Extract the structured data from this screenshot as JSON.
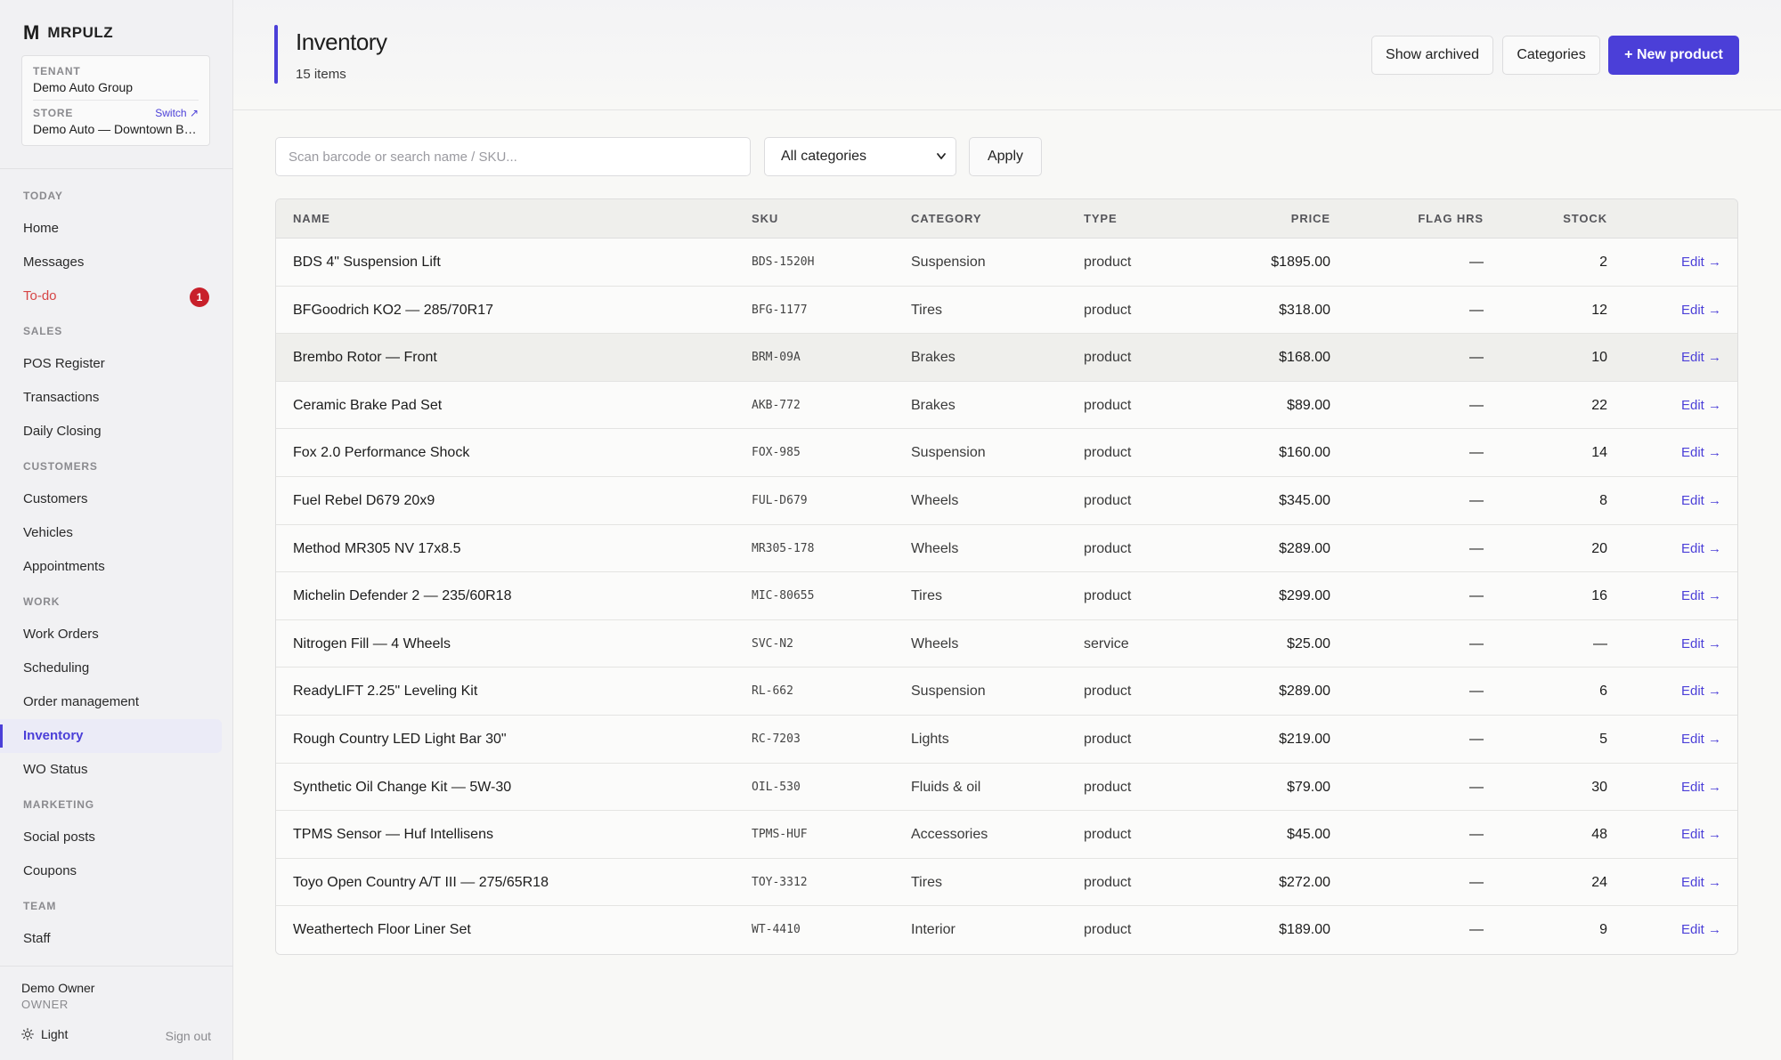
{
  "brand": {
    "logo": "M",
    "name": "MRPULZ"
  },
  "context": {
    "tenant_label": "TENANT",
    "tenant_value": "Demo Auto Group",
    "store_label": "STORE",
    "store_value": "Demo Auto — Downtown Branch",
    "switch_label": "Switch ↗"
  },
  "nav": {
    "sections": [
      {
        "label": "TODAY",
        "items": [
          {
            "label": "Home"
          },
          {
            "label": "Messages"
          },
          {
            "label": "To-do",
            "badge": "1"
          }
        ]
      },
      {
        "label": "SALES",
        "items": [
          {
            "label": "POS Register"
          },
          {
            "label": "Transactions"
          },
          {
            "label": "Daily Closing"
          }
        ]
      },
      {
        "label": "CUSTOMERS",
        "items": [
          {
            "label": "Customers"
          },
          {
            "label": "Vehicles"
          },
          {
            "label": "Appointments"
          }
        ]
      },
      {
        "label": "WORK",
        "items": [
          {
            "label": "Work Orders"
          },
          {
            "label": "Scheduling"
          },
          {
            "label": "Order management"
          },
          {
            "label": "Inventory",
            "active": true
          },
          {
            "label": "WO Status"
          }
        ]
      },
      {
        "label": "MARKETING",
        "items": [
          {
            "label": "Social posts"
          },
          {
            "label": "Coupons"
          }
        ]
      },
      {
        "label": "TEAM",
        "items": [
          {
            "label": "Staff"
          }
        ]
      }
    ]
  },
  "footer": {
    "owner_name": "Demo Owner",
    "owner_role": "OWNER",
    "theme_label": "Light",
    "signout_label": "Sign out"
  },
  "header": {
    "title": "Inventory",
    "subtitle": "15 items"
  },
  "actions": {
    "show_archived": "Show archived",
    "categories": "Categories",
    "new_product": "+ New product"
  },
  "filters": {
    "search_placeholder": "Scan barcode or search name / SKU...",
    "category_selected": "All categories",
    "apply_label": "Apply"
  },
  "table": {
    "columns": {
      "name": "NAME",
      "sku": "SKU",
      "category": "CATEGORY",
      "type": "TYPE",
      "price": "PRICE",
      "flag_hrs": "FLAG HRS",
      "stock": "STOCK"
    },
    "edit_label": "Edit →",
    "highlight_row": 2,
    "rows": [
      {
        "name": "BDS 4\" Suspension Lift",
        "sku": "BDS-1520H",
        "category": "Suspension",
        "type": "product",
        "price": "$1895.00",
        "flag_hrs": "—",
        "stock": "2"
      },
      {
        "name": "BFGoodrich KO2 — 285/70R17",
        "sku": "BFG-1177",
        "category": "Tires",
        "type": "product",
        "price": "$318.00",
        "flag_hrs": "—",
        "stock": "12"
      },
      {
        "name": "Brembo Rotor — Front",
        "sku": "BRM-09A",
        "category": "Brakes",
        "type": "product",
        "price": "$168.00",
        "flag_hrs": "—",
        "stock": "10"
      },
      {
        "name": "Ceramic Brake Pad Set",
        "sku": "AKB-772",
        "category": "Brakes",
        "type": "product",
        "price": "$89.00",
        "flag_hrs": "—",
        "stock": "22"
      },
      {
        "name": "Fox 2.0 Performance Shock",
        "sku": "FOX-985",
        "category": "Suspension",
        "type": "product",
        "price": "$160.00",
        "flag_hrs": "—",
        "stock": "14"
      },
      {
        "name": "Fuel Rebel D679 20x9",
        "sku": "FUL-D679",
        "category": "Wheels",
        "type": "product",
        "price": "$345.00",
        "flag_hrs": "—",
        "stock": "8"
      },
      {
        "name": "Method MR305 NV 17x8.5",
        "sku": "MR305-178",
        "category": "Wheels",
        "type": "product",
        "price": "$289.00",
        "flag_hrs": "—",
        "stock": "20"
      },
      {
        "name": "Michelin Defender 2 — 235/60R18",
        "sku": "MIC-80655",
        "category": "Tires",
        "type": "product",
        "price": "$299.00",
        "flag_hrs": "—",
        "stock": "16"
      },
      {
        "name": "Nitrogen Fill — 4 Wheels",
        "sku": "SVC-N2",
        "category": "Wheels",
        "type": "service",
        "price": "$25.00",
        "flag_hrs": "—",
        "stock": "—"
      },
      {
        "name": "ReadyLIFT 2.25\" Leveling Kit",
        "sku": "RL-662",
        "category": "Suspension",
        "type": "product",
        "price": "$289.00",
        "flag_hrs": "—",
        "stock": "6"
      },
      {
        "name": "Rough Country LED Light Bar 30\"",
        "sku": "RC-7203",
        "category": "Lights",
        "type": "product",
        "price": "$219.00",
        "flag_hrs": "—",
        "stock": "5"
      },
      {
        "name": "Synthetic Oil Change Kit — 5W-30",
        "sku": "OIL-530",
        "category": "Fluids & oil",
        "type": "product",
        "price": "$79.00",
        "flag_hrs": "—",
        "stock": "30"
      },
      {
        "name": "TPMS Sensor — Huf Intellisens",
        "sku": "TPMS-HUF",
        "category": "Accessories",
        "type": "product",
        "price": "$45.00",
        "flag_hrs": "—",
        "stock": "48"
      },
      {
        "name": "Toyo Open Country A/T III — 275/65R18",
        "sku": "TOY-3312",
        "category": "Tires",
        "type": "product",
        "price": "$272.00",
        "flag_hrs": "—",
        "stock": "24"
      },
      {
        "name": "Weathertech Floor Liner Set",
        "sku": "WT-4410",
        "category": "Interior",
        "type": "product",
        "price": "$189.00",
        "flag_hrs": "—",
        "stock": "9"
      }
    ]
  },
  "colors": {
    "accent": "#4b3fd8",
    "alert": "#d64545",
    "badge": "#c8202a"
  },
  "icons": {
    "theme": "sun-icon",
    "select": "chevron-down-icon"
  }
}
